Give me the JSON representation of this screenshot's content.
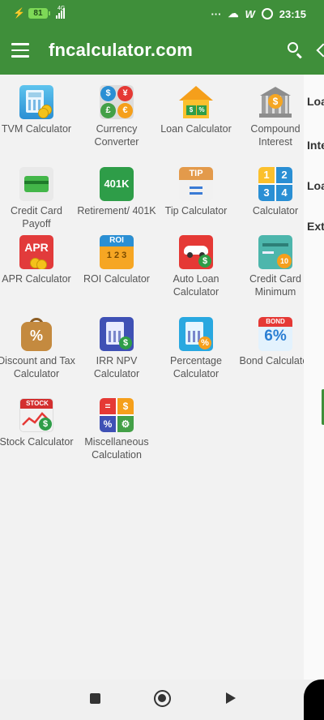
{
  "status_bar": {
    "battery": "81",
    "network": "4G",
    "time": "23:15",
    "more": "···"
  },
  "app_bar": {
    "title": "fncalculator.com"
  },
  "calculators": [
    {
      "label": "TVM Calculator"
    },
    {
      "label": "Currency Converter"
    },
    {
      "label": "Loan Calculator"
    },
    {
      "label": "Compound Interest"
    },
    {
      "label": "Credit Card Payoff"
    },
    {
      "label": "Retirement/ 401K"
    },
    {
      "label": "Tip Calculator"
    },
    {
      "label": "Calculator"
    },
    {
      "label": "APR Calculator"
    },
    {
      "label": "ROI Calculator"
    },
    {
      "label": "Auto Loan Calculator"
    },
    {
      "label": "Credit Card Minimum"
    },
    {
      "label": "Discount and Tax Calculator"
    },
    {
      "label": "IRR NPV Calculator"
    },
    {
      "label": "Percentage Calculator"
    },
    {
      "label": "Bond Calculator"
    },
    {
      "label": "Stock Calculator"
    },
    {
      "label": "Miscellaneous Calculation"
    }
  ],
  "icon_text": {
    "currency": [
      "$",
      "¥",
      "£",
      "€"
    ],
    "loan": [
      "$",
      "%"
    ],
    "compound": "$",
    "retirement": "401K",
    "tip": "TIP",
    "calc_digits": [
      "1",
      "2",
      "3",
      "4"
    ],
    "apr": "APR",
    "roi_head": "ROI",
    "roi_digits": "1 2 3",
    "auto": "$",
    "cc_min": "10",
    "discount": "%",
    "irr": "$",
    "percentage": "%",
    "bond_head": "BOND",
    "bond_value": "6%",
    "stock_head": "STOCK",
    "stock": "$",
    "misc": [
      "=",
      "$",
      "%",
      "⚙"
    ]
  },
  "side_panel": [
    "Loa",
    "Inte",
    "Loa",
    "Ext"
  ],
  "colors": {
    "primary": "#3f8f3a",
    "background": "#f2f2f2",
    "label": "#555555"
  }
}
